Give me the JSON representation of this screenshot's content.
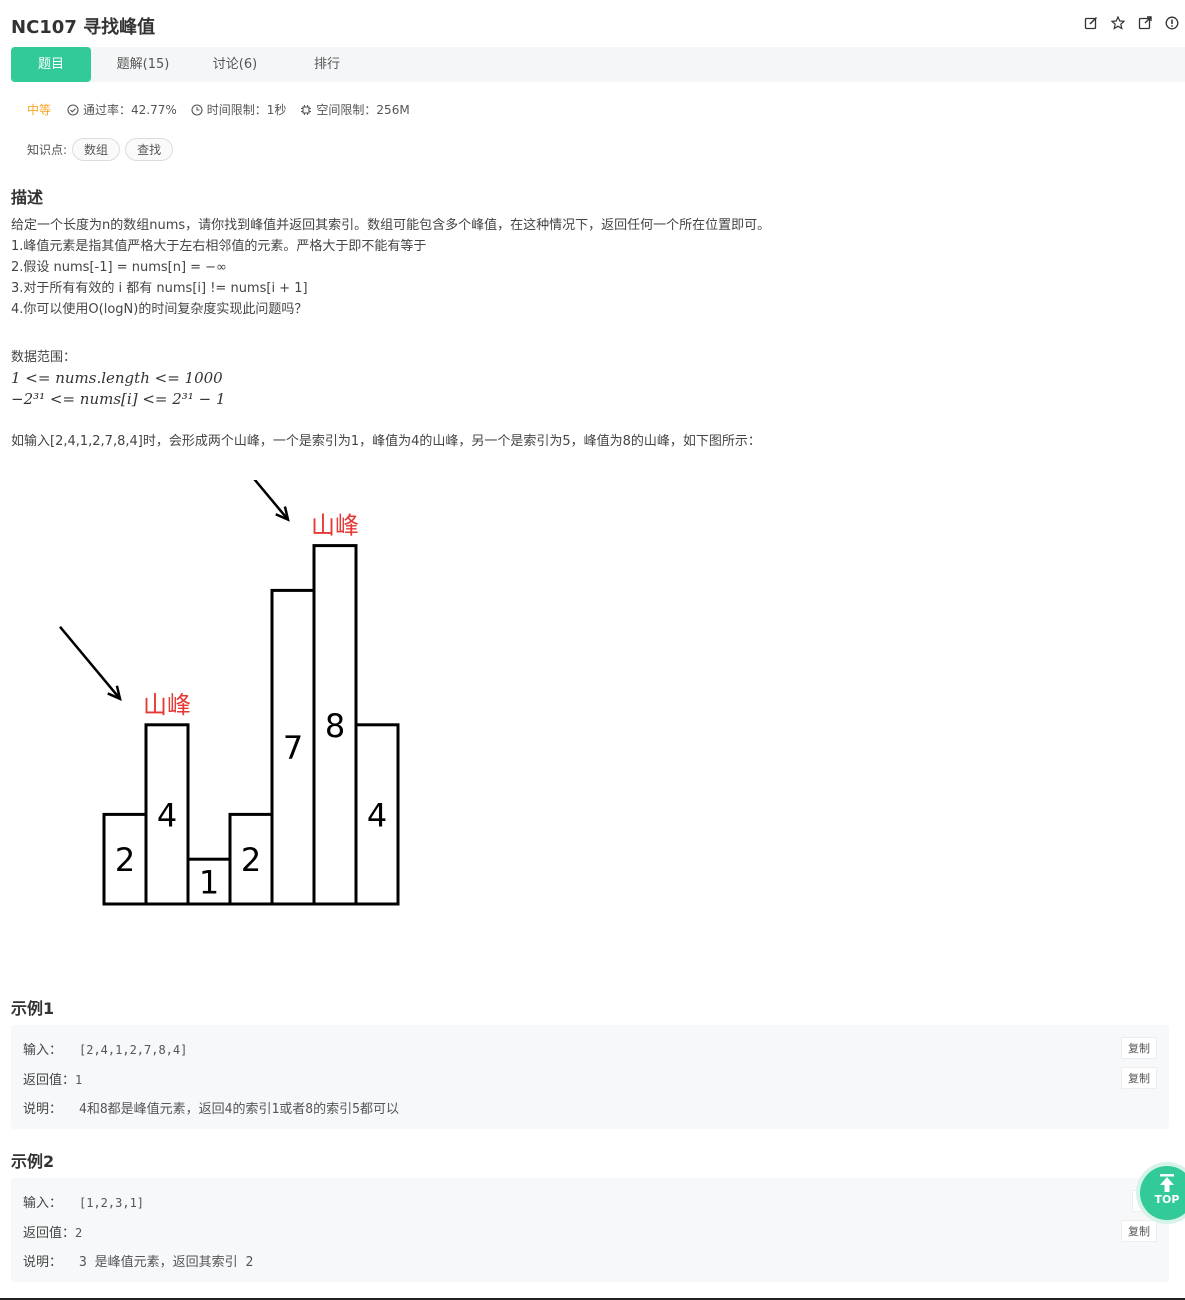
{
  "header": {
    "title": "NC107  寻找峰值"
  },
  "tabs": [
    {
      "label": "题目",
      "active": true
    },
    {
      "label": "题解(15)"
    },
    {
      "label": "讨论(6)"
    },
    {
      "label": "排行"
    }
  ],
  "meta": {
    "difficulty": "中等",
    "pass_rate": "通过率：42.77%",
    "time_limit": "时间限制：1秒",
    "space_limit": "空间限制：256M"
  },
  "knowledge": {
    "label": "知识点:",
    "tags": [
      "数组",
      "查找"
    ]
  },
  "description": {
    "heading": "描述",
    "lines": [
      "给定一个长度为n的数组nums，请你找到峰值并返回其索引。数组可能包含多个峰值，在这种情况下，返回任何一个所在位置即可。",
      "1.峰值元素是指其值严格大于左右相邻值的元素。严格大于即不能有等于",
      "2.假设 nums[-1] = nums[n] = −∞",
      "3.对于所有有效的 i 都有 nums[i] != nums[i + 1]",
      "4.你可以使用O(logN)的时间复杂度实现此问题吗？"
    ],
    "range_label": "数据范围：",
    "range_line1": "1 <= nums.length <= 1000",
    "range_line2": "−2³¹ <= nums[i] <= 2³¹ − 1",
    "example_text": "如输入[2,4,1,2,7,8,4]时，会形成两个山峰，一个是索引为1，峰值为4的山峰，另一个是索引为5，峰值为8的山峰，如下图所示："
  },
  "figure": {
    "values": [
      2,
      4,
      1,
      2,
      7,
      8,
      4
    ],
    "peak_label": "山峰"
  },
  "examples": [
    {
      "heading": "示例1",
      "input_label": "输入：",
      "input": "[2,4,1,2,7,8,4]",
      "output_label": "返回值：",
      "output": "1",
      "explain_label": "说明：",
      "explain": "4和8都是峰值元素，返回4的索引1或者8的索引5都可以",
      "copy": "复制"
    },
    {
      "heading": "示例2",
      "input_label": "输入：",
      "input": "[1,2,3,1]",
      "output_label": "返回值：",
      "output": "2",
      "explain_label": "说明：",
      "explain": "3 是峰值元素，返回其索引 2",
      "copy": "复制",
      "copy_partial": "复"
    }
  ],
  "top_button": {
    "label": "TOP"
  }
}
